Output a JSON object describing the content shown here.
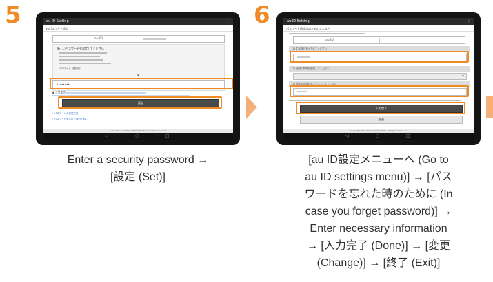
{
  "step5": {
    "number": "5",
    "app_title": "au ID Setting",
    "sub_header": "auパスワード設定",
    "id_label": "au ID",
    "heading_text": "新しいパスワードを設定してください",
    "field_label": "パスワード（確認用）",
    "field_value": "••••••••",
    "set_button_label": "設定",
    "footer_text": "Copyright (C) KDDI CORPORATION, All Rights Reserved",
    "caption_lines": [
      "Enter a security password →",
      "[設定 (Set)]"
    ]
  },
  "step6": {
    "number": "6",
    "app_title": "au ID Setting",
    "sub_header": "パスワード再設定のためのメニュー",
    "id_label": "au ID",
    "q1_label": "(1) 生年月日を入力してください",
    "q2_label": "(2) 秘密の質問を選択してください",
    "q2_select": "",
    "q3_label": "(3) 秘密の質問の答えを入力してください",
    "done_button_label": "入力完了",
    "change_button_label": "変更",
    "footer_text": "Copyright (C) KDDI CORPORATION, All Rights Reserved",
    "caption_lines": [
      "[au ID設定メニューへ (Go to",
      "au ID settings menu)] → [パス",
      "ワードを忘れた時のために (In",
      "case you forget password)] →",
      "Enter necessary information",
      "→ [入力完了 (Done)] → [変更",
      "(Change)] → [終了 (Exit)]"
    ]
  },
  "colors": {
    "accent": "#f08a24",
    "arrow": "#f5b07a",
    "tablet_frame": "#141414"
  }
}
